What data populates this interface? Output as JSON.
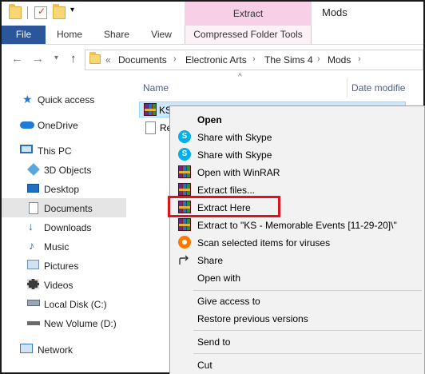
{
  "window": {
    "title": "Mods",
    "contextual_group": "Extract"
  },
  "ribbon": {
    "tabs": [
      {
        "label": "File",
        "active": true
      },
      {
        "label": "Home"
      },
      {
        "label": "Share"
      },
      {
        "label": "View"
      },
      {
        "label": "Compressed Folder Tools"
      }
    ]
  },
  "address": {
    "overflow": "«",
    "breadcrumbs": [
      "Documents",
      "Electronic Arts",
      "The Sims 4",
      "Mods"
    ]
  },
  "nav": {
    "items": [
      {
        "label": "Quick access",
        "icon": "star-icon"
      },
      {
        "label": "OneDrive",
        "icon": "cloud-icon"
      },
      {
        "label": "This PC",
        "icon": "computer-icon"
      },
      {
        "label": "3D Objects",
        "icon": "cube-icon"
      },
      {
        "label": "Desktop",
        "icon": "desktop-icon"
      },
      {
        "label": "Documents",
        "icon": "documents-icon",
        "selected": true
      },
      {
        "label": "Downloads",
        "icon": "download-icon"
      },
      {
        "label": "Music",
        "icon": "music-icon"
      },
      {
        "label": "Pictures",
        "icon": "pictures-icon"
      },
      {
        "label": "Videos",
        "icon": "videos-icon"
      },
      {
        "label": "Local Disk (C:)",
        "icon": "local-disk-icon"
      },
      {
        "label": "New Volume (D:)",
        "icon": "drive-icon"
      },
      {
        "label": "Network",
        "icon": "network-icon"
      }
    ]
  },
  "files": {
    "columns": {
      "name": "Name",
      "date": "Date modifie"
    },
    "rows": [
      {
        "name": "KS",
        "icon": "winrar-archive-icon",
        "selected": true
      },
      {
        "name": "Re",
        "icon": "text-document-icon"
      }
    ]
  },
  "context_menu": {
    "items": [
      {
        "label": "Open",
        "bold": true
      },
      {
        "label": "Share with Skype",
        "icon": "skype-icon"
      },
      {
        "label": "Share with Skype",
        "icon": "skype-icon"
      },
      {
        "label": "Open with WinRAR",
        "icon": "winrar-icon"
      },
      {
        "label": "Extract files...",
        "icon": "winrar-icon"
      },
      {
        "label": "Extract Here",
        "icon": "winrar-icon",
        "highlighted": true
      },
      {
        "label": "Extract to \"KS - Memorable Events [11-29-20]\\\"",
        "icon": "winrar-icon"
      },
      {
        "label": "Scan selected items for viruses",
        "icon": "avast-icon"
      },
      {
        "label": "Share",
        "icon": "share-icon"
      },
      {
        "label": "Open with"
      },
      {
        "label": "Give access to"
      },
      {
        "label": "Restore previous versions"
      },
      {
        "label": "Send to"
      },
      {
        "label": "Cut"
      }
    ]
  },
  "colors": {
    "file_tab": "#2b579a",
    "contextual_tab": "#f7cfe6",
    "selection": "#cce8ff",
    "highlight_box": "#d9151e"
  }
}
